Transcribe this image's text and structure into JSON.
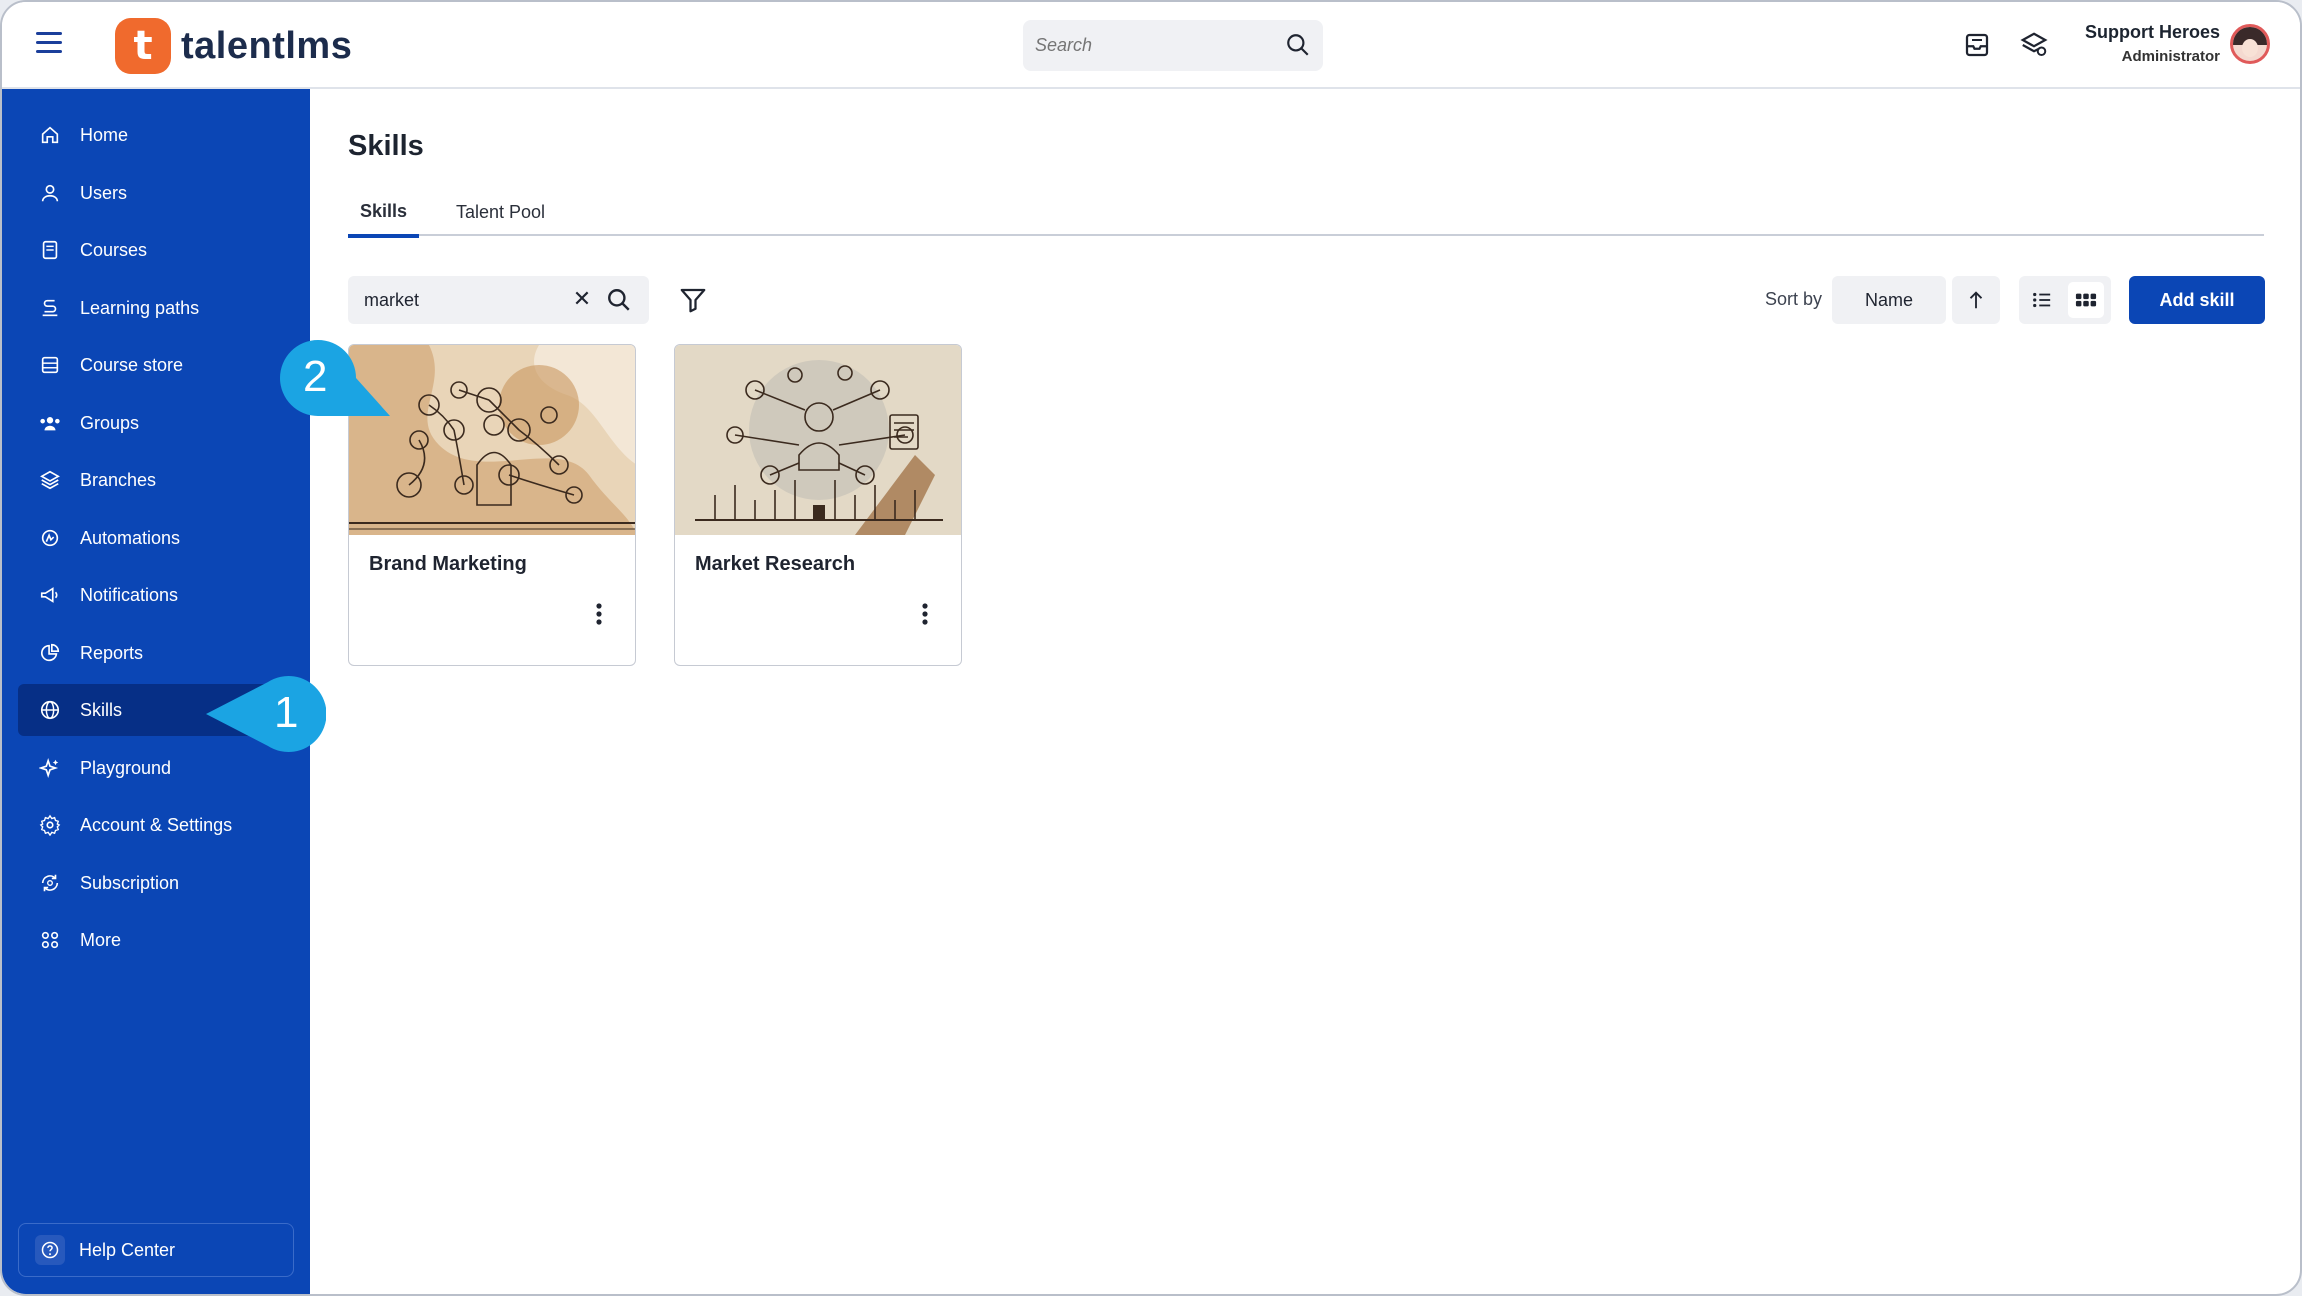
{
  "header": {
    "logo_letter": "t",
    "logo_text": "talentlms",
    "search_placeholder": "Search",
    "user_name": "Support Heroes",
    "user_role": "Administrator"
  },
  "sidebar": {
    "items": [
      {
        "label": "Home",
        "icon": "home-icon"
      },
      {
        "label": "Users",
        "icon": "user-icon"
      },
      {
        "label": "Courses",
        "icon": "book-icon"
      },
      {
        "label": "Learning paths",
        "icon": "path-icon"
      },
      {
        "label": "Course store",
        "icon": "store-icon"
      },
      {
        "label": "Groups",
        "icon": "groups-icon"
      },
      {
        "label": "Branches",
        "icon": "layers-icon"
      },
      {
        "label": "Automations",
        "icon": "automation-icon"
      },
      {
        "label": "Notifications",
        "icon": "megaphone-icon"
      },
      {
        "label": "Reports",
        "icon": "pie-chart-icon"
      },
      {
        "label": "Skills",
        "icon": "globe-icon",
        "active": true
      },
      {
        "label": "Playground",
        "icon": "sparkle-icon"
      },
      {
        "label": "Account & Settings",
        "icon": "gear-icon"
      },
      {
        "label": "Subscription",
        "icon": "refresh-icon"
      },
      {
        "label": "More",
        "icon": "grid-dots-icon"
      }
    ],
    "help_label": "Help Center"
  },
  "main": {
    "title": "Skills",
    "tabs": [
      {
        "label": "Skills",
        "active": true
      },
      {
        "label": "Talent Pool",
        "active": false
      }
    ],
    "search_value": "market",
    "sort_label": "Sort by",
    "sort_value": "Name",
    "add_button": "Add skill",
    "cards": [
      {
        "name": "Brand Marketing"
      },
      {
        "name": "Market Research"
      }
    ]
  },
  "callouts": [
    "1",
    "2"
  ],
  "colors": {
    "sidebar": "#0b46b5",
    "sidebar_active": "#062f86",
    "accent": "#0b46b5",
    "logo": "#f06a2d",
    "callout": "#1ba4e3"
  }
}
